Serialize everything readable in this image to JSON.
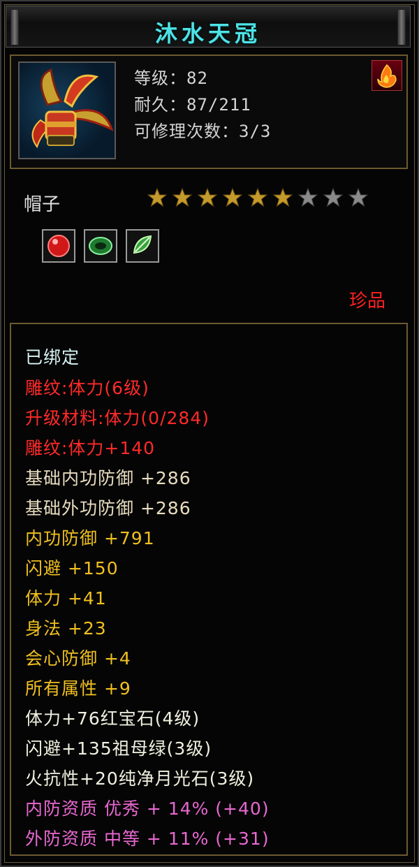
{
  "title": "沐水天冠",
  "header": {
    "level": "等级：82",
    "durability": "耐久：87/211",
    "repair": "可修理次数：3/3"
  },
  "item_type": "帽子",
  "stars": {
    "total": 9,
    "filled": 6
  },
  "gems": [
    "red-gem-icon",
    "green-ring-icon",
    "green-jade-icon"
  ],
  "rarity": "珍品",
  "colors": {
    "title": "#4ee2e6",
    "red": "#ff2a2a",
    "gold": "#f0c020",
    "pink": "#e868d0",
    "beige": "#e8dcc0"
  },
  "attributes": {
    "bound": "已绑定",
    "engrave1": "雕纹:体力(6级)",
    "upgrade": "升级材料:体力(0/284)",
    "engrave2": "雕纹:体力+140",
    "base_inner": "基础内功防御 +286",
    "base_outer": "基础外功防御 +286",
    "inner_def": "内功防御 +791",
    "dodge": "闪避 +150",
    "stamina": "体力 +41",
    "agility": "身法 +23",
    "crit_def": "会心防御 +4",
    "all_attr": "所有属性 +9",
    "gem1": "体力+76红宝石(4级)",
    "gem2": "闪避+135祖母绿(3级)",
    "gem3": "火抗性+20纯净月光石(3级)",
    "inner_quality": "内防资质 优秀 + 14% (+40)",
    "outer_quality": "外防资质 中等 + 11% (+31)"
  }
}
